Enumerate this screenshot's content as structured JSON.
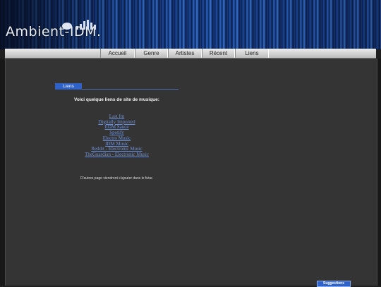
{
  "site": {
    "logo_text": "Ambient-IDM."
  },
  "nav": {
    "items": [
      {
        "label": "Accueil"
      },
      {
        "label": "Genre"
      },
      {
        "label": "Artistes"
      },
      {
        "label": "Récent"
      },
      {
        "label": "Liens"
      }
    ]
  },
  "section": {
    "tab_label": "Liens"
  },
  "content": {
    "intro": "Voici quelque liens de site de musique:",
    "links": [
      "Last fm",
      "Digitally Imported",
      "EDM Sauce",
      "Spotify",
      "Electro Music",
      "IDM Music",
      "Reddit - Electronic Music",
      "TheGuardian - Electronic Music"
    ],
    "future_note": "D'autres page viendront s'ajouter dans le futur."
  },
  "footer": {
    "suggestions_label": "Suggestions"
  },
  "colors": {
    "accent": "#2f62c9",
    "link": "#6b8fd8",
    "background": "#343434"
  }
}
